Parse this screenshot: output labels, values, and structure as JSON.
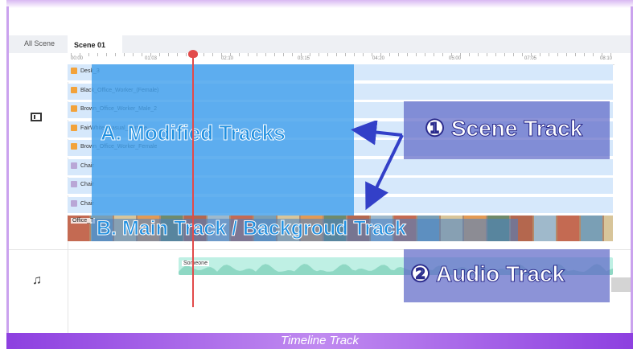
{
  "tabs": {
    "all_scene": "All Scene",
    "scene_01": "Scene 01"
  },
  "ruler": {
    "ticks": [
      "00:00",
      "01:03",
      "02:10",
      "03:15",
      "04:20",
      "05:00",
      "07:05",
      "08:10"
    ]
  },
  "tracks": [
    {
      "label": "Desk_3",
      "icon": "person-icon"
    },
    {
      "label": "Black_Office_Worker_(Female)",
      "icon": "person-icon"
    },
    {
      "label": "Brown_Office_Worker_Male_2",
      "icon": "person-icon"
    },
    {
      "label": "FairWhite_Casual_Female",
      "icon": "person-icon"
    },
    {
      "label": "Brown_Office_Worker_Female",
      "icon": "person-icon"
    },
    {
      "label": "Chair",
      "icon": "chair-icon"
    },
    {
      "label": "Chair",
      "icon": "chair-icon"
    },
    {
      "label": "Chair",
      "icon": "chair-icon"
    }
  ],
  "main_track": {
    "label": "Office_T"
  },
  "audio_track": {
    "label": "Someone"
  },
  "annotations": {
    "modified": "A. Modified Tracks",
    "main": "B. Main Track / Backgroud Track",
    "scene": "❶ Scene Track",
    "audio": "❷ Audio Track"
  },
  "footer": {
    "caption": "Timeline Track"
  },
  "colors": {
    "accent": "#8d3fe0",
    "playhead": "#e24a4a",
    "callout": "#5f69c8",
    "highlight": "#42a0eb"
  }
}
